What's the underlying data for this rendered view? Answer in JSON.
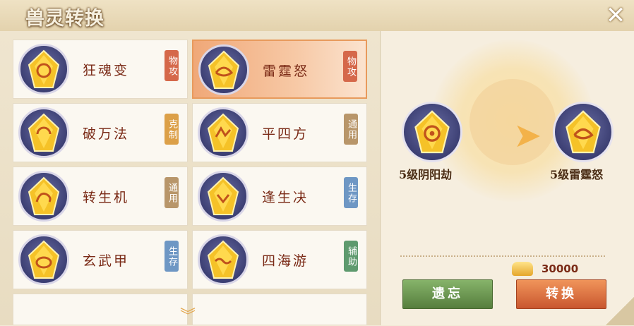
{
  "header": {
    "title": "兽灵转换",
    "close_label": "✕"
  },
  "skills": [
    {
      "name": "狂魂变",
      "tag": "物攻",
      "tag_color": "red",
      "selected": false
    },
    {
      "name": "雷霆怒",
      "tag": "物攻",
      "tag_color": "red",
      "selected": true
    },
    {
      "name": "破万法",
      "tag": "克制",
      "tag_color": "orange",
      "selected": false
    },
    {
      "name": "平四方",
      "tag": "通用",
      "tag_color": "brown",
      "selected": false
    },
    {
      "name": "转生机",
      "tag": "通用",
      "tag_color": "brown",
      "selected": false
    },
    {
      "name": "逢生决",
      "tag": "生存",
      "tag_color": "blue",
      "selected": false
    },
    {
      "name": "玄武甲",
      "tag": "生存",
      "tag_color": "blue",
      "selected": false
    },
    {
      "name": "四海游",
      "tag": "辅助",
      "tag_color": "green",
      "selected": false
    }
  ],
  "conversion": {
    "from_label": "5级阴阳劫",
    "to_label": "5级雷霆怒",
    "cost": "30000"
  },
  "buttons": {
    "forget_label": "遗忘",
    "convert_label": "转换"
  },
  "colors": {
    "accent": "#e89a5c",
    "title_brown": "#7a2a16",
    "gem_gold": "#f5c228"
  }
}
